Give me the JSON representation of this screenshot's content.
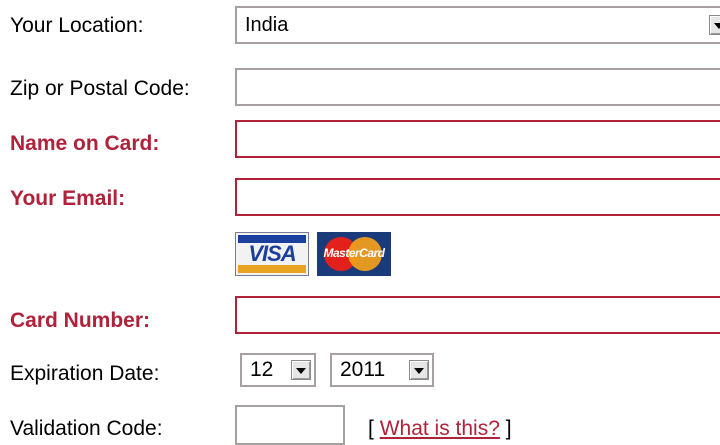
{
  "fields": {
    "location": {
      "label": "Your Location:",
      "value": "India"
    },
    "zip": {
      "label": "Zip or Postal Code:",
      "value": ""
    },
    "name": {
      "label": "Name on Card:",
      "value": ""
    },
    "email": {
      "label": "Your Email:",
      "value": ""
    },
    "card_number": {
      "label": "Card Number:",
      "value": ""
    },
    "expiration": {
      "label": "Expiration Date:",
      "month": "12",
      "year": "2011"
    },
    "validation": {
      "label": "Validation Code:",
      "value": ""
    }
  },
  "cards": {
    "visa": "VISA",
    "mastercard": "MasterCard"
  },
  "help": {
    "open": "[",
    "link": "What is this?",
    "close": "]"
  },
  "colors": {
    "required_label": "#b0223a",
    "required_border": "#b0223a",
    "field_border": "#a8a0a0"
  }
}
